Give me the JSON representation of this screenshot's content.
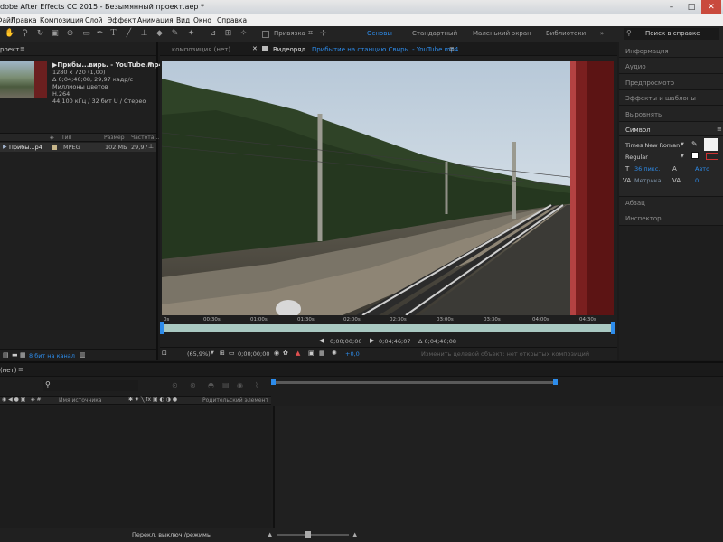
{
  "window": {
    "title": "dobe After Effects CC 2015 - Безымянный проект.aep *",
    "controls": [
      "–",
      "□",
      "✕"
    ]
  },
  "menu": [
    "Файл",
    "Правка",
    "Композиция",
    "Слой",
    "Эффект",
    "Анимация",
    "Вид",
    "Окно",
    "Справка"
  ],
  "toolbar": {
    "snap_label": "Привязка",
    "workspaces": [
      "Основы",
      "Стандартный",
      "Маленький экран",
      "Библиотеки"
    ],
    "active_workspace": "Основы",
    "search_placeholder": "Поиск в справке"
  },
  "project": {
    "tab_label": "роект",
    "item_name": "▶Прибы...вирь. - YouTube.mp4",
    "details": [
      "1280 x 720 (1,00)",
      "Δ 0;04;46;08, 29,97 кадр/с",
      "Миллионы цветов",
      "H.264",
      "44,100 кГц / 32 бит U / Стерео"
    ],
    "columns": {
      "type": "Тип",
      "size": "Размер",
      "rate": "Частота..."
    },
    "row": {
      "name": "Прибы...p4",
      "type": "MPEG",
      "size": "102 MБ",
      "rate": "29,97"
    },
    "footer_label": "8 бит на канал"
  },
  "viewer": {
    "comp_tab": "композиция (нет)",
    "footage_tab_label": "Видеоряд",
    "footage_tab_file": "Прибытие на станцию Свирь. - YouTube.mp4",
    "ruler_labels": [
      "0s",
      "00:30s",
      "01:00s",
      "01:30s",
      "02:00s",
      "02:30s",
      "03:00s",
      "03:30s",
      "04:00s",
      "04:30s"
    ],
    "in_point": "0;00;00;00",
    "out_point": "0;04;46;07",
    "duration": "Δ 0;04;46;08",
    "zoom": "(65,9%)",
    "current_time": "0;00;00;00",
    "exposure": "+0,0",
    "hint": "Изменить целевой объект: нет открытых композиций"
  },
  "right_panel": {
    "items_top": [
      "Информация",
      "Аудио",
      "Предпросмотр",
      "Эффекты и шаблоны",
      "Выровнять"
    ],
    "symbol_tab": "Символ",
    "font_name": "Times New Roman",
    "font_style": "Regular",
    "font_size": "36 пикс.",
    "leading": "Авто",
    "kerning": "Метрика",
    "tracking": "0",
    "items_bottom": [
      "Абзац",
      "Инспектор"
    ]
  },
  "timeline": {
    "tab_label": "(нет)",
    "columns": {
      "source": "Имя источника",
      "parent": "Родительский элемент"
    }
  },
  "status": {
    "toggle_label": "Перекл. выключ./режимы"
  },
  "colors": {
    "accent": "#2d8ceb",
    "ruler": "#a9c9c2",
    "footage_label": "#c7b68a"
  }
}
